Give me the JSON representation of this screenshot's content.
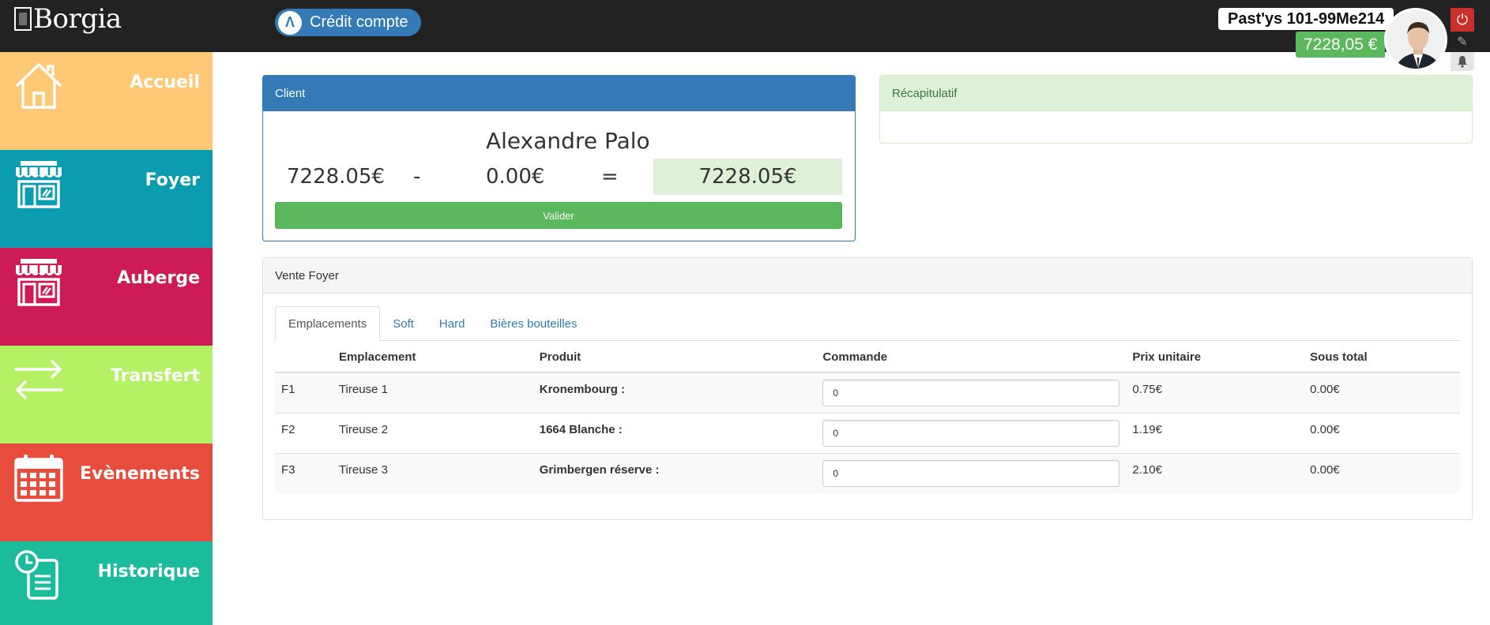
{
  "header": {
    "logo_text": "Borgia",
    "credit_button_label": "Crédit compte",
    "user_name": "Past'ys 101-99Me214",
    "balance": "7228,05 €"
  },
  "sidebar": {
    "items": [
      {
        "label": "Accueil",
        "icon": "home-icon",
        "color": "#ffc874"
      },
      {
        "label": "Foyer",
        "icon": "shop-icon",
        "color": "#0a9db0"
      },
      {
        "label": "Auberge",
        "icon": "shop-icon",
        "color": "#cd1c55"
      },
      {
        "label": "Transfert",
        "icon": "transfer-arrows-icon",
        "color": "#b6f065"
      },
      {
        "label": "Evènements",
        "icon": "calendar-icon",
        "color": "#e74c3c"
      },
      {
        "label": "Historique",
        "icon": "history-clock-icon",
        "color": "#1abc9c"
      }
    ]
  },
  "client_panel": {
    "heading": "Client",
    "client_name": "Alexandre Palo",
    "balance": "7228.05€",
    "minus": "-",
    "debit": "0.00€",
    "equals": "=",
    "result": "7228.05€",
    "validate_label": "Valider"
  },
  "recap_panel": {
    "heading": "Récapitulatif"
  },
  "vente_panel": {
    "heading": "Vente Foyer",
    "tabs": [
      {
        "label": "Emplacements",
        "active": true
      },
      {
        "label": "Soft",
        "active": false
      },
      {
        "label": "Hard",
        "active": false
      },
      {
        "label": "Bières bouteilles",
        "active": false
      }
    ],
    "columns": [
      "",
      "Emplacement",
      "Produit",
      "Commande",
      "Prix unitaire",
      "Sous total"
    ],
    "rows": [
      {
        "code": "F1",
        "emplacement": "Tireuse 1",
        "produit": "Kronembourg :",
        "commande": "0",
        "prix": "0.75€",
        "sous_total": "0.00€"
      },
      {
        "code": "F2",
        "emplacement": "Tireuse 2",
        "produit": "1664 Blanche :",
        "commande": "0",
        "prix": "1.19€",
        "sous_total": "0.00€"
      },
      {
        "code": "F3",
        "emplacement": "Tireuse 3",
        "produit": "Grimbergen réserve :",
        "commande": "0",
        "prix": "2.10€",
        "sous_total": "0.00€"
      }
    ]
  }
}
